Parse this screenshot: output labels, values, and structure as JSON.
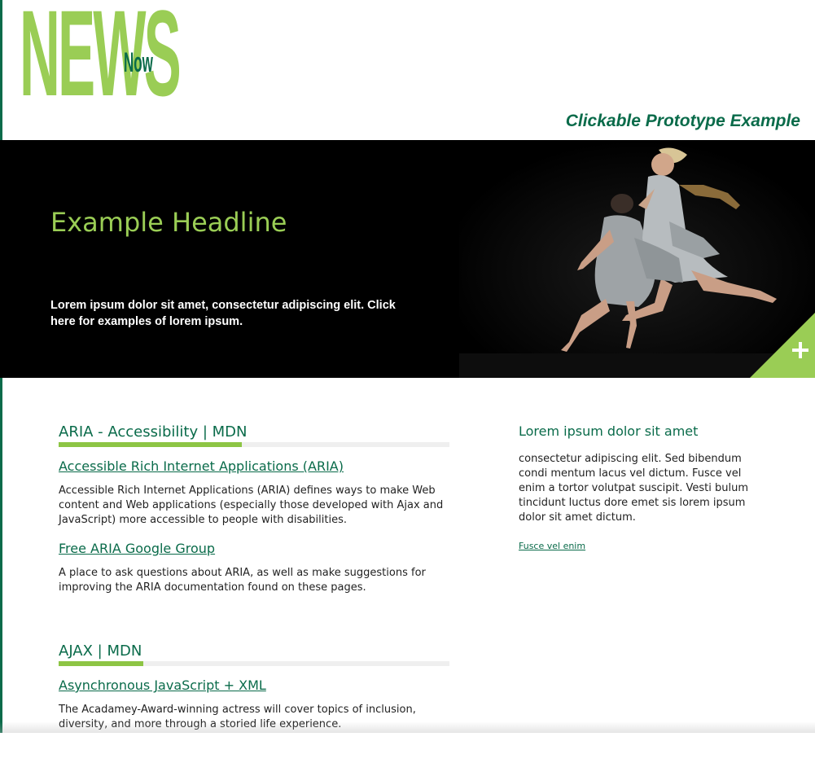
{
  "brand": {
    "news": "NEWS",
    "now": "Now",
    "tagline": "Clickable Prototype Example"
  },
  "hero": {
    "headline": "Example Headline",
    "subtext": "Lorem ipsum dolor sit amet, consectetur adipiscing elit. Click here for examples of lorem ipsum.",
    "expand_icon": "plus-icon"
  },
  "sections": [
    {
      "title": "ARIA - Accessibility | MDN",
      "items": [
        {
          "link": "Accessible Rich Internet Applications (ARIA)",
          "text": "Accessible Rich Internet Applications (ARIA) defines ways to make Web content and Web applications (especially those developed with Ajax and JavaScript) more accessible to people with disabilities."
        },
        {
          "link": "Free ARIA Google Group",
          "text": "A place to ask questions about ARIA, as well as make suggestions for improving the ARIA documentation found on these pages."
        }
      ]
    },
    {
      "title": "AJAX | MDN",
      "items": [
        {
          "link": "Asynchronous JavaScript + XML",
          "text": "The Acadamey-Award-winning actress will cover topics of inclusion, diversity, and more through a storied life experience."
        }
      ]
    }
  ],
  "aside": {
    "title": "Lorem ipsum dolor sit amet",
    "body": "consectetur adipiscing elit. Sed bibendum condi mentum lacus vel dictum. Fusce vel enim a tortor volutpat suscipit. Vesti bulum tincidunt luctus dore emet sis lorem ipsum dolor sit amet dictum.",
    "link": "Fusce vel enim"
  },
  "colors": {
    "accent_green": "#9acd55",
    "dark_green": "#0a6b4a",
    "hero_bg": "#000000"
  }
}
